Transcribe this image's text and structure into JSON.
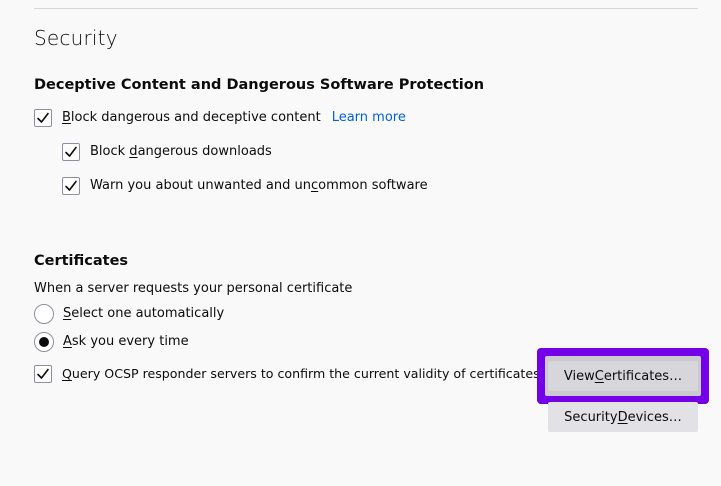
{
  "section": {
    "title": "Security"
  },
  "deceptive": {
    "heading": "Deceptive Content and Dangerous Software Protection",
    "block_label_prefix": "",
    "block_label_accel": "B",
    "block_label_rest": "lock dangerous and deceptive content",
    "learn_more": "Learn more",
    "downloads_label_pre": "Block ",
    "downloads_label_accel": "d",
    "downloads_label_rest": "angerous downloads",
    "unwanted_label_pre": "Warn you about unwanted and un",
    "unwanted_label_accel": "c",
    "unwanted_label_rest": "ommon software",
    "block_checked": true,
    "downloads_checked": true,
    "unwanted_checked": true
  },
  "certificates": {
    "heading": "Certificates",
    "description": "When a server requests your personal certificate",
    "radio_auto_accel": "S",
    "radio_auto_rest": "elect one automatically",
    "radio_ask_accel": "A",
    "radio_ask_rest": "sk you every time",
    "selected": "ask",
    "ocsp_accel": "Q",
    "ocsp_rest": "uery OCSP responder servers to confirm the current validity of certificates",
    "ocsp_checked": true,
    "view_button_pre": "View ",
    "view_button_accel": "C",
    "view_button_rest": "ertificates…",
    "devices_button_pre": "Security ",
    "devices_button_accel": "D",
    "devices_button_rest": "evices…"
  },
  "colors": {
    "highlight": "#7300e6",
    "link": "#0060df",
    "button": "#e1e1e6"
  }
}
